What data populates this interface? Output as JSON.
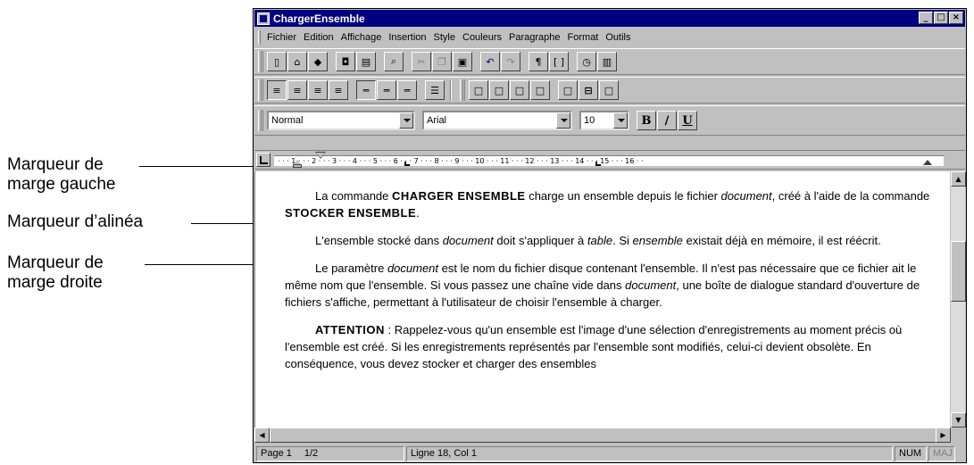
{
  "callouts": {
    "left_margin": [
      "Marqueur de",
      "marge gauche"
    ],
    "indent": "Marqueur d’alinéa",
    "right_margin": [
      "Marqueur de",
      "marge droite"
    ]
  },
  "window": {
    "title": "ChargerEnsemble",
    "controls": [
      "minimize-icon",
      "maximize-icon",
      "close-icon"
    ]
  },
  "menubar": [
    "Fichier",
    "Edition",
    "Affichage",
    "Insertion",
    "Style",
    "Couleurs",
    "Paragraphe",
    "Format",
    "Outils"
  ],
  "format_toolbar": {
    "style": "Normal",
    "font": "Arial",
    "size": "10",
    "bold": "B",
    "italic": "/",
    "underline": "U"
  },
  "ruler": {
    "labels": "· · · 1 · · · 2 · · · 3 · · · 4 · · · 5 · · · 6 · · · 7 · · · 8 · · · 9 · · · 10 · · · 11 · · · 12 · · · 13 · · · 14 · · · 15 · · · 16 · ·"
  },
  "document": {
    "p1": {
      "a": "La commande ",
      "b1": "CHARGER ENSEMBLE",
      "c": " charge un ensemble depuis le fichier ",
      "i1": "document",
      "d": ", créé à l'aide de la commande ",
      "b2": "STOCKER ENSEMBLE",
      "e": "."
    },
    "p2": {
      "a": "L'ensemble stocké dans ",
      "i1": "document",
      "b": " doit s'appliquer à ",
      "i2": "table",
      "c": ". Si ",
      "i3": "ensemble",
      "d": " existait déjà en mémoire, il est réécrit."
    },
    "p3": {
      "a": "Le paramètre ",
      "i1": "document",
      "b": " est le nom du fichier disque contenant l'ensemble. Il n'est pas nécessaire que ce fichier ait le même nom que l'ensemble. Si vous passez une chaîne vide dans ",
      "i2": "document",
      "c": ", une boîte de dialogue standard d'ouverture de fichiers s'affiche, permettant à l'utilisateur de choisir l'ensemble à charger."
    },
    "p4": {
      "b1": "ATTENTION",
      "a": " : Rappelez-vous qu'un ensemble est l'image d'une sélection d'enregistrements au moment précis où l'ensemble est créé. Si les enregistrements représentés par l'ensemble sont modifiés, celui-ci devient obsolète. En conséquence, vous devez stocker et charger des ensembles"
    }
  },
  "statusbar": {
    "page": "Page 1",
    "pages": "1/2",
    "position": "Ligne 18, Col 1",
    "num": "NUM",
    "maj": "MAJ"
  }
}
